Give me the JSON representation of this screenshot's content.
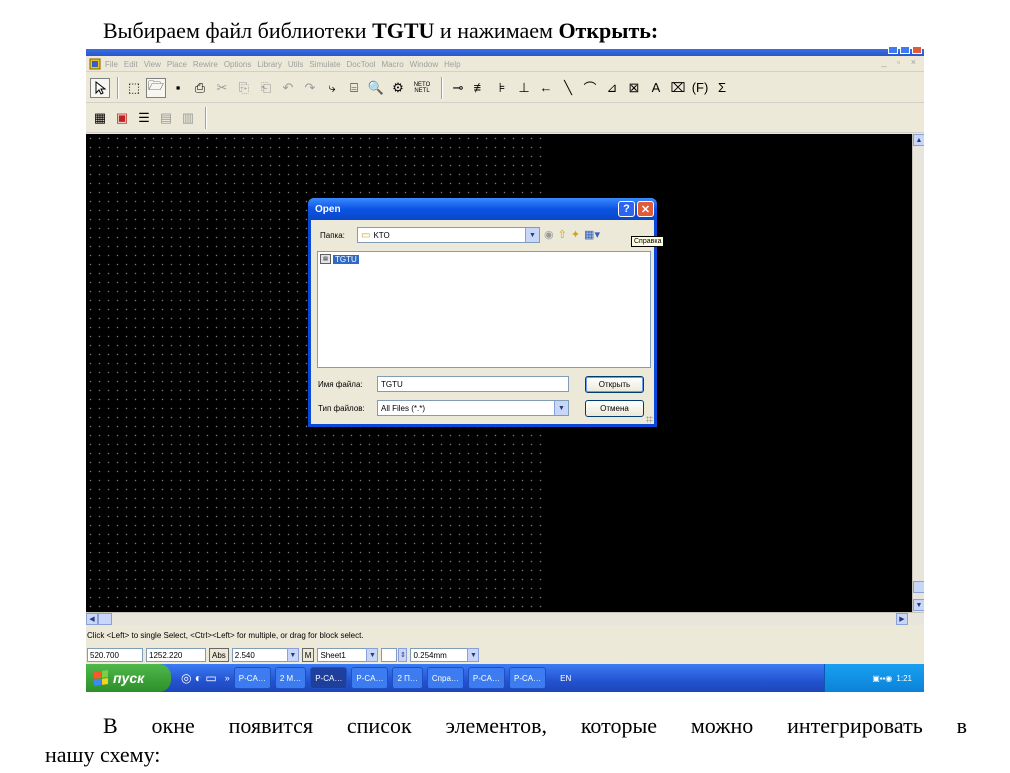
{
  "document": {
    "heading_prefix": "Выбираем файл библиотеки ",
    "heading_bold_1": "TGTU",
    "heading_middle": " и нажимаем ",
    "heading_bold_2": "Открыть:",
    "para_line1": "В окне появится список элементов, которые можно интегрировать в",
    "para_line2": "нашу схему:"
  },
  "app": {
    "menu": [
      "File",
      "Edit",
      "View",
      "Place",
      "Rewire",
      "Options",
      "Library",
      "Utils",
      "Simulate",
      "DocTool",
      "Macro",
      "Window",
      "Help"
    ],
    "mdi_controls": "_ ▫ ×",
    "toolbar1_main": [
      "⬚",
      "🗁",
      "▪",
      "⎙",
      "✂",
      "⎘",
      "⎗",
      "↶",
      "↷",
      "⤷",
      "⌸",
      "🔍",
      "⚙"
    ],
    "netlist_label": "NETO\nNETL",
    "toolbar1_place": [
      "⊸",
      "≢",
      "⊧",
      "⊥",
      "←",
      "╲",
      "⌒",
      "⊿",
      "⊠",
      "A",
      "⌧",
      "(F)",
      "Σ"
    ],
    "toolbar2": [
      "▦",
      "▣",
      "☰",
      "▤",
      "▥"
    ]
  },
  "status": {
    "hint": "Click <Left> to single Select, <Ctrl><Left> for multiple, or drag for block select.",
    "x": "520.700",
    "y": "1252.220",
    "abs": "Abs",
    "grid": "2.540",
    "m_btn": "M",
    "sheet": "Sheet1",
    "line_width": "0.254mm"
  },
  "taskbar": {
    "start": "пуск",
    "quicklaunch": "◎ ◐ ▭",
    "chevron": "»",
    "tasks": [
      "P-CA…",
      "2 M…",
      "P-CA…",
      "P-CA…",
      "2 П…",
      "Спра…",
      "P-CA…",
      "P-CA…"
    ],
    "lang": "EN",
    "clock": "1:21"
  },
  "dialog": {
    "title": "Open",
    "help_btn": "?",
    "close_btn": "✕",
    "folder_label": "Папка:",
    "folder_value": "KTO",
    "file_item": "TGTU",
    "filename_label": "Имя файла:",
    "filename_value": "TGTU",
    "filetype_label": "Тип файлов:",
    "filetype_value": "All Files (*.*)",
    "open_btn": "Открыть",
    "cancel_btn": "Отмена",
    "tooltip": "Справка"
  },
  "colors": {
    "canvas": "#000000",
    "xp_blue": "#0c54e4",
    "start_green": "#2d8f2a"
  }
}
